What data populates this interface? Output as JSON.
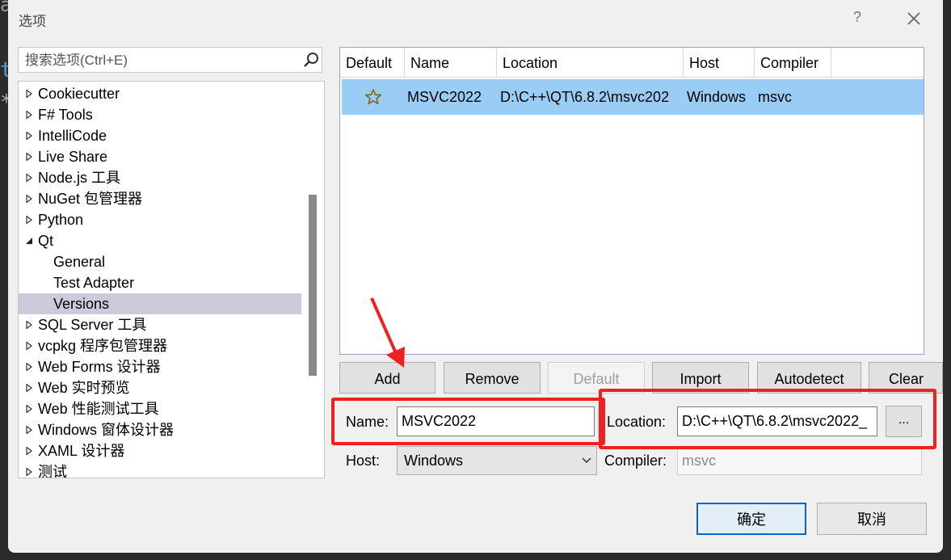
{
  "window": {
    "title": "选项",
    "help_glyph": "?"
  },
  "background_glyphs": [
    "a",
    "t",
    "*"
  ],
  "search": {
    "placeholder": "搜索选项(Ctrl+E)"
  },
  "tree": {
    "items": [
      {
        "label": "Cookiecutter",
        "level": 0,
        "expanded": false
      },
      {
        "label": "F# Tools",
        "level": 0,
        "expanded": false
      },
      {
        "label": "IntelliCode",
        "level": 0,
        "expanded": false
      },
      {
        "label": "Live Share",
        "level": 0,
        "expanded": false
      },
      {
        "label": "Node.js 工具",
        "level": 0,
        "expanded": false
      },
      {
        "label": "NuGet 包管理器",
        "level": 0,
        "expanded": false
      },
      {
        "label": "Python",
        "level": 0,
        "expanded": false
      },
      {
        "label": "Qt",
        "level": 0,
        "expanded": true
      },
      {
        "label": "General",
        "level": 1
      },
      {
        "label": "Test Adapter",
        "level": 1
      },
      {
        "label": "Versions",
        "level": 1,
        "selected": true
      },
      {
        "label": "SQL Server 工具",
        "level": 0,
        "expanded": false
      },
      {
        "label": "vcpkg 程序包管理器",
        "level": 0,
        "expanded": false
      },
      {
        "label": "Web Forms 设计器",
        "level": 0,
        "expanded": false
      },
      {
        "label": "Web 实时预览",
        "level": 0,
        "expanded": false
      },
      {
        "label": "Web 性能测试工具",
        "level": 0,
        "expanded": false
      },
      {
        "label": "Windows 窗体设计器",
        "level": 0,
        "expanded": false
      },
      {
        "label": "XAML 设计器",
        "level": 0,
        "expanded": false
      },
      {
        "label": "测试",
        "level": 0,
        "expanded": false
      }
    ]
  },
  "grid": {
    "columns": [
      "Default",
      "Name",
      "Location",
      "Host",
      "Compiler"
    ],
    "rows": [
      {
        "default_icon": "star-icon",
        "name": "MSVC2022",
        "location": "D:\\C++\\QT\\6.8.2\\msvc202",
        "host": "Windows",
        "compiler": "msvc"
      }
    ]
  },
  "buttons": {
    "add": "Add",
    "remove": "Remove",
    "default": "Default",
    "import": "Import",
    "autodetect": "Autodetect",
    "clear": "Clear"
  },
  "form": {
    "name_label": "Name:",
    "name_value": "MSVC2022",
    "location_label": "Location:",
    "location_value": "D:\\C++\\QT\\6.8.2\\msvc2022_",
    "browse_label": "...",
    "host_label": "Host:",
    "host_value": "Windows",
    "compiler_label": "Compiler:",
    "compiler_value": "msvc"
  },
  "footer": {
    "ok": "确定",
    "cancel": "取消"
  },
  "colors": {
    "selection": "#99cdf5",
    "annotation_red": "#f02020",
    "ok_border": "#0a64c8"
  }
}
